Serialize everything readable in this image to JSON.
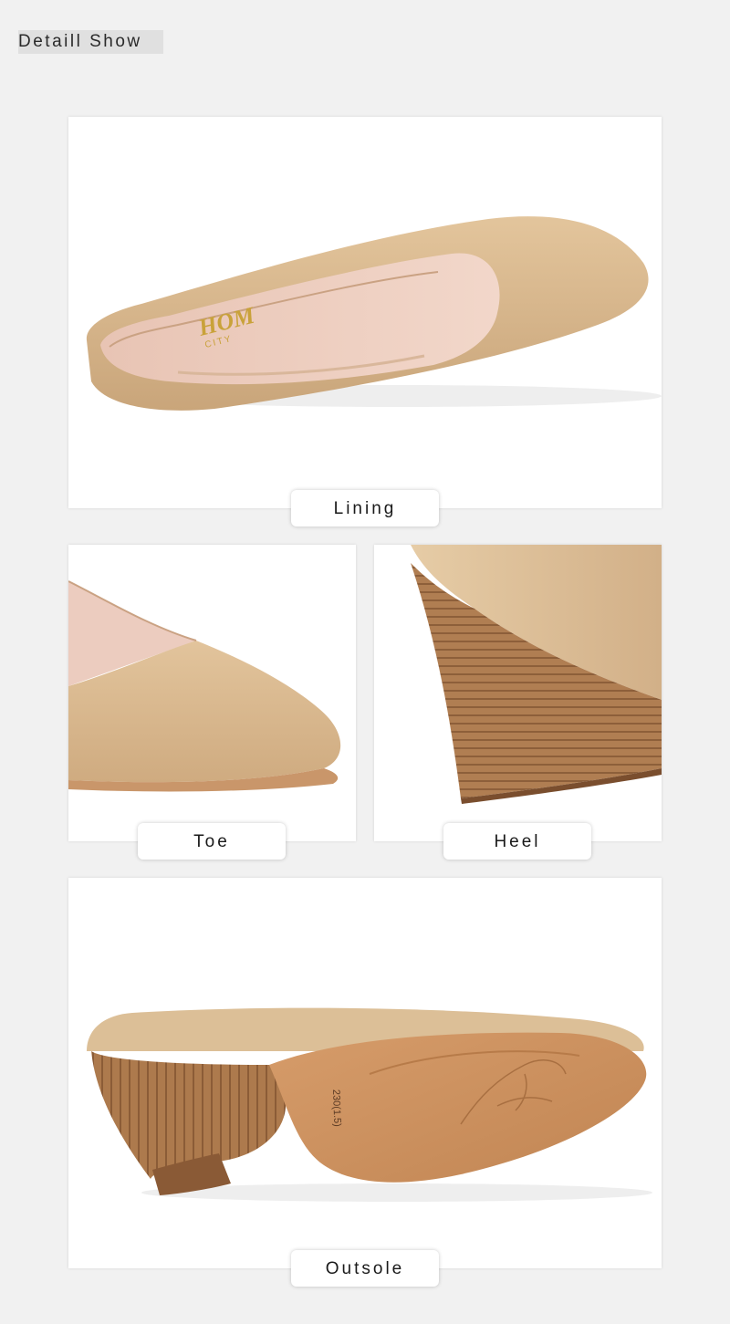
{
  "page": {
    "title": "Detaill Show",
    "background": "#f1f1f1"
  },
  "panels": {
    "lining": {
      "caption": "Lining"
    },
    "toe": {
      "caption": "Toe"
    },
    "heel": {
      "caption": "Heel"
    },
    "outsole": {
      "caption": "Outsole"
    }
  },
  "product": {
    "insole_logo": "HOM",
    "insole_logo_sub": "CITY",
    "outsole_size_mark": "230(1.5)",
    "colors": {
      "leather": "#d8b88f",
      "leather_shadow": "#b9956b",
      "lining": "#ebcabd",
      "wood": "#a9774b",
      "wood_dark": "#8a5a34",
      "sole": "#c98f5d",
      "logo_gold": "#c9a23a"
    }
  }
}
